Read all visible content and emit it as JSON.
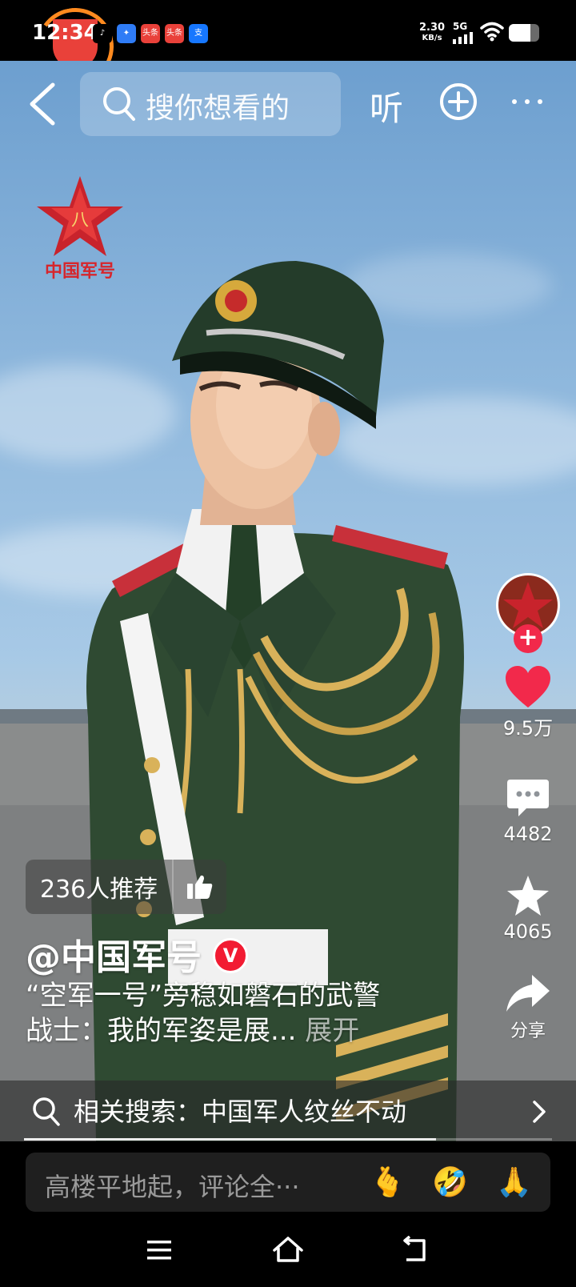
{
  "status_bar": {
    "time": "12:34",
    "app_icons": [
      {
        "name": "tiktok-icon",
        "label": "♪",
        "color": "#000000"
      },
      {
        "name": "feather-icon",
        "label": "✦",
        "color": "#2f7cf6"
      },
      {
        "name": "toutiao-icon",
        "label": "头条",
        "color": "#e9413a"
      },
      {
        "name": "toutiao-icon-2",
        "label": "头条",
        "color": "#e9413a"
      },
      {
        "name": "alipay-icon",
        "label": "支",
        "color": "#1677ff"
      }
    ],
    "net_speed_value": "2.30",
    "net_speed_unit": "KB/s",
    "network": "5G",
    "battery_level": 0.7
  },
  "header": {
    "search_placeholder": "搜你想看的",
    "listen_label": "听"
  },
  "watermark": {
    "emblem_glyph": "八",
    "text": "中国军号"
  },
  "rail": {
    "likes": "9.5万",
    "comments": "4482",
    "favorites": "4065",
    "share_label": "分享"
  },
  "post": {
    "recommend_label": "236人推荐",
    "author": "@中国军号",
    "verified_glyph": "V",
    "caption_line1": "“空军一号”旁稳如磐石的武警",
    "caption_line2": "战士：我的军姿是展...",
    "expand_label": "展开"
  },
  "related_search": {
    "label": "相关搜索：中国军人纹丝不动"
  },
  "progress": {
    "value": 0.78
  },
  "comment_bar": {
    "placeholder": "高楼平地起，评论全···",
    "emojis": [
      "🫰",
      "🤣",
      "🙏"
    ]
  },
  "colors": {
    "accent_red": "#f2294b",
    "like_red": "#f2294b"
  }
}
